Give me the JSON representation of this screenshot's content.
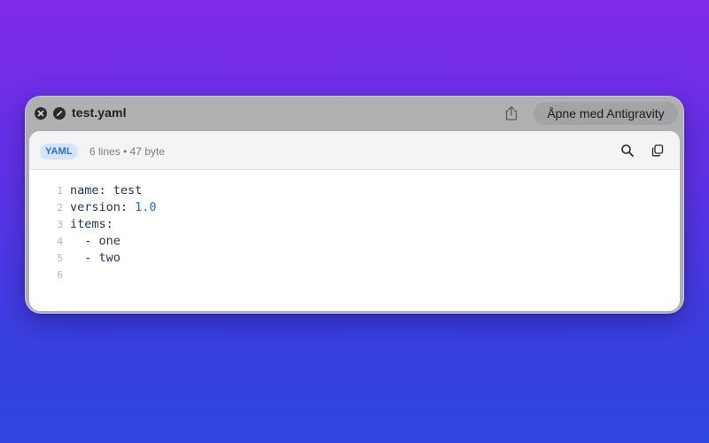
{
  "window": {
    "title": "test.yaml",
    "open_button_label": "Åpne med Antigravity"
  },
  "icons": {
    "close": "close-icon",
    "disable": "slash-circle-icon",
    "share": "share-icon",
    "search": "search-icon",
    "copy": "copy-icon"
  },
  "file": {
    "language": "YAML",
    "meta": "6 lines • 47 byte"
  },
  "code": {
    "lines": [
      {
        "number": "1",
        "key": "name:",
        "value": " test",
        "value_type": "plain"
      },
      {
        "number": "2",
        "key": "version:",
        "value": " 1.0",
        "value_type": "number"
      },
      {
        "number": "3",
        "key": "items:",
        "value": "",
        "value_type": "plain"
      },
      {
        "number": "4",
        "key": "  - one",
        "value": "",
        "value_type": "plain"
      },
      {
        "number": "5",
        "key": "  - two",
        "value": "",
        "value_type": "plain"
      },
      {
        "number": "6",
        "key": "",
        "value": "",
        "value_type": "plain"
      }
    ]
  },
  "colors": {
    "background_top": "#7f2ae8",
    "background_bottom": "#2f46df",
    "badge_text": "#2a6fd1",
    "badge_bg": "#d3e4fb",
    "number_literal": "#2a6fd1",
    "code_text": "#1e3457"
  }
}
